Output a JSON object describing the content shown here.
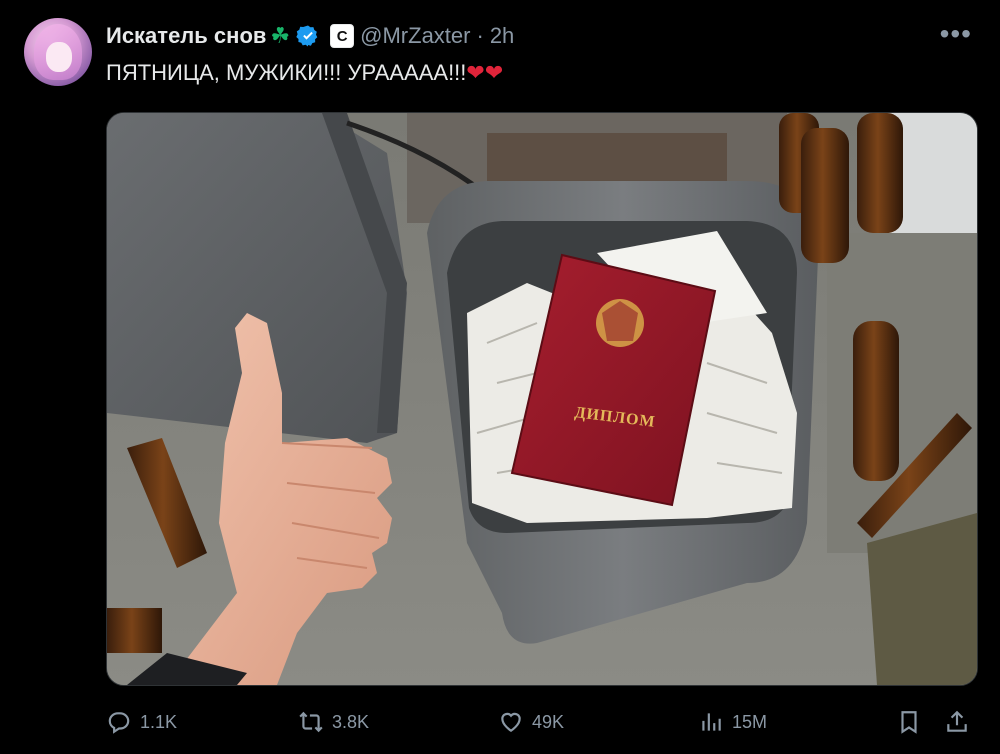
{
  "author": {
    "display_name": "Искатель снов",
    "emoji": "☘",
    "handle": "@MrZaxter",
    "separator": "·",
    "time": "2h",
    "affiliate_badge": "C"
  },
  "tweet": {
    "text": "ПЯТНИЦА, МУЖИКИ!!! УРААААА!!!",
    "hearts": "❤❤"
  },
  "media": {
    "diploma_text": "ДИПЛОМ"
  },
  "actions": {
    "replies": "1.1K",
    "retweets": "3.8K",
    "likes": "49K",
    "views": "15M"
  },
  "icons": {
    "more": "more-dots-icon",
    "verified": "verified-badge-icon",
    "reply": "reply-icon",
    "retweet": "retweet-icon",
    "like": "heart-icon",
    "views": "views-chart-icon",
    "bookmark": "bookmark-icon",
    "share": "share-icon"
  },
  "colors": {
    "background": "#000000",
    "text": "#e7e9ea",
    "muted": "#8b98a5",
    "verified": "#1d9bf0",
    "heart": "#e0243a"
  }
}
